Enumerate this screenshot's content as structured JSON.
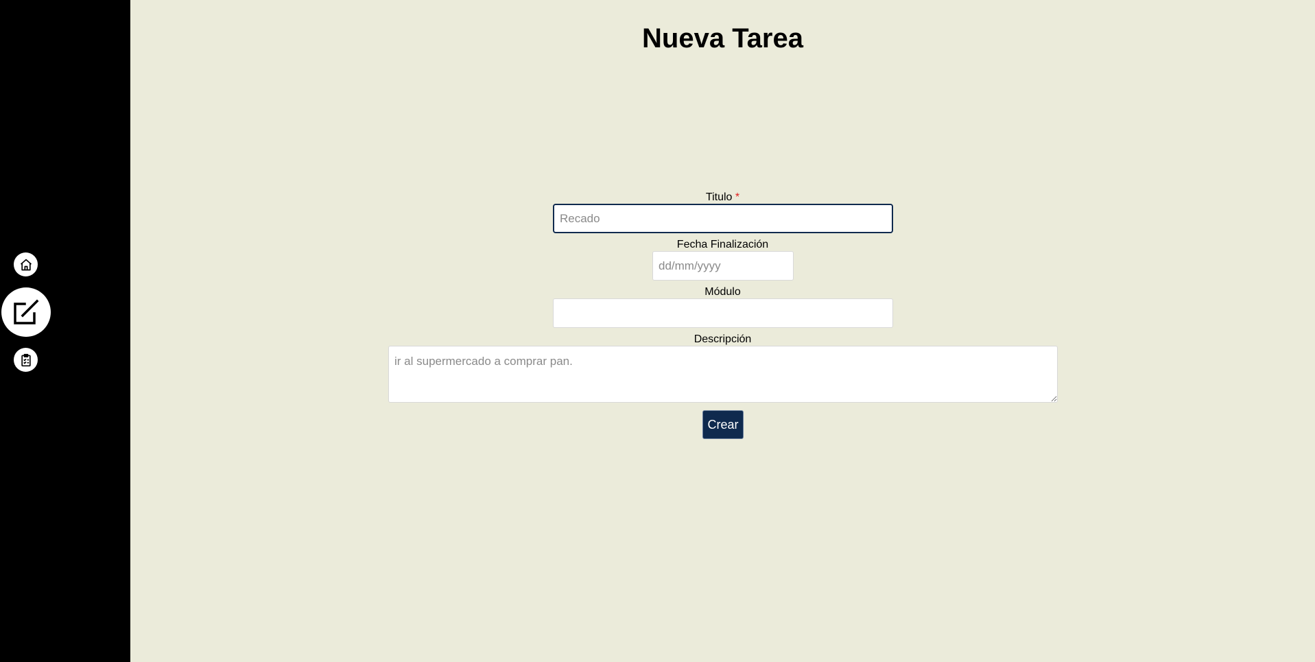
{
  "sidebar": {
    "items": [
      {
        "name": "home",
        "icon": "home-icon"
      },
      {
        "name": "new-task",
        "icon": "edit-icon",
        "active": true
      },
      {
        "name": "task-list",
        "icon": "clipboard-check-icon"
      }
    ]
  },
  "page": {
    "title": "Nueva Tarea"
  },
  "form": {
    "titulo": {
      "label": "Titulo",
      "required_mark": "*",
      "placeholder": "Recado",
      "value": ""
    },
    "fecha": {
      "label": "Fecha Finalización",
      "placeholder": "dd/mm/yyyy",
      "value": ""
    },
    "modulo": {
      "label": "Módulo",
      "placeholder": "",
      "value": ""
    },
    "descripcion": {
      "label": "Descripción",
      "placeholder": "ir al supermercado a comprar pan.",
      "value": ""
    },
    "submit_label": "Crear"
  },
  "colors": {
    "background": "#ebebda",
    "sidebar": "#000000",
    "accent": "#0f2a4e",
    "required": "#e02020"
  }
}
